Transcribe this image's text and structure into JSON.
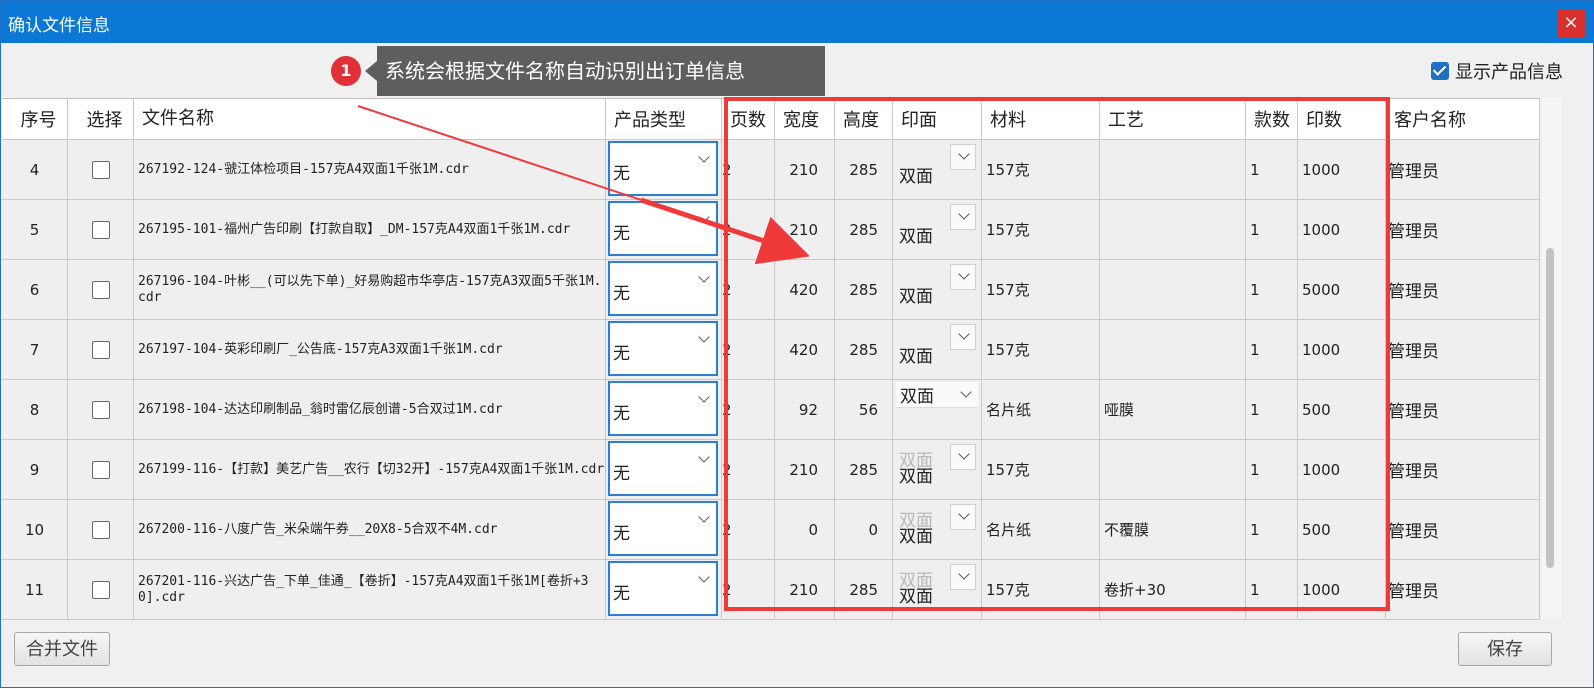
{
  "window": {
    "title": "确认文件信息",
    "close_label": "×"
  },
  "callout": {
    "badge": "1",
    "text": "系统会根据文件名称自动识别出订单信息"
  },
  "show_product_info": {
    "label": "显示产品信息",
    "checked": true
  },
  "columns": [
    "序号",
    "选择",
    "文件名称",
    "产品类型",
    "页数",
    "宽度",
    "高度",
    "印面",
    "材料",
    "工艺",
    "款数",
    "印数",
    "客户名称"
  ],
  "rows": [
    {
      "idx": "4",
      "file": "267192-124-虢江体检项目-157克A4双面1千张1M.cdr",
      "type": "无",
      "pages": "2",
      "width": "210",
      "height": "285",
      "side": "双面",
      "side_ghost": "",
      "side_style": "box",
      "material": "157克",
      "craft": "",
      "count": "1",
      "prints": "1000",
      "customer": "管理员"
    },
    {
      "idx": "5",
      "file": "267195-101-福州广告印刷【打款自取】_DM-157克A4双面1千张1M.cdr",
      "type": "无",
      "pages": "2",
      "width": "210",
      "height": "285",
      "side": "双面",
      "side_ghost": "",
      "side_style": "box",
      "material": "157克",
      "craft": "",
      "count": "1",
      "prints": "1000",
      "customer": "管理员"
    },
    {
      "idx": "6",
      "file": "267196-104-叶彬__(可以先下单)_好易购超市华亭店-157克A3双面5千张1M.cdr",
      "type": "无",
      "pages": "2",
      "width": "420",
      "height": "285",
      "side": "双面",
      "side_ghost": "",
      "side_style": "box",
      "material": "157克",
      "craft": "",
      "count": "1",
      "prints": "5000",
      "customer": "管理员"
    },
    {
      "idx": "7",
      "file": "267197-104-英彩印刷厂_公告底-157克A3双面1千张1M.cdr",
      "type": "无",
      "pages": "2",
      "width": "420",
      "height": "285",
      "side": "双面",
      "side_ghost": "",
      "side_style": "box",
      "material": "157克",
      "craft": "",
      "count": "1",
      "prints": "1000",
      "customer": "管理员"
    },
    {
      "idx": "8",
      "file": "267198-104-达达印刷制品_翁时雷亿辰创谱-5合双过1M.cdr",
      "type": "无",
      "pages": "2",
      "width": "92",
      "height": "56",
      "side": "双面",
      "side_ghost": "",
      "side_style": "top",
      "material": "名片纸",
      "craft": "哑膜",
      "count": "1",
      "prints": "500",
      "customer": "管理员"
    },
    {
      "idx": "9",
      "file": "267199-116-【打款】美艺广告__农行【切32开】-157克A4双面1千张1M.cdr",
      "type": "无",
      "pages": "2",
      "width": "210",
      "height": "285",
      "side": "双面",
      "side_ghost": "双面",
      "side_style": "ghost",
      "material": "157克",
      "craft": "",
      "count": "1",
      "prints": "1000",
      "customer": "管理员"
    },
    {
      "idx": "10",
      "file": "267200-116-八度广告_米朵端午券__20X8-5合双不4M.cdr",
      "type": "无",
      "pages": "2",
      "width": "0",
      "height": "0",
      "side": "双面",
      "side_ghost": "双面",
      "side_style": "ghost",
      "material": "名片纸",
      "craft": "不覆膜",
      "count": "1",
      "prints": "500",
      "customer": "管理员"
    },
    {
      "idx": "11",
      "file": "267201-116-兴达广告_下单_佳通_【卷折】-157克A4双面1千张1M[卷折+30].cdr",
      "type": "无",
      "pages": "2",
      "width": "210",
      "height": "285",
      "side": "双面",
      "side_ghost": "双面",
      "side_style": "ghost",
      "material": "157克",
      "craft": "卷折+30",
      "count": "1",
      "prints": "1000",
      "customer": "管理员"
    }
  ],
  "buttons": {
    "merge": "合并文件",
    "save": "保存"
  },
  "colors": {
    "titlebar": "#0a78d4",
    "highlight": "#ef3a3a",
    "callout_bg": "#5e5e5e",
    "accent": "#1f6fc4"
  }
}
